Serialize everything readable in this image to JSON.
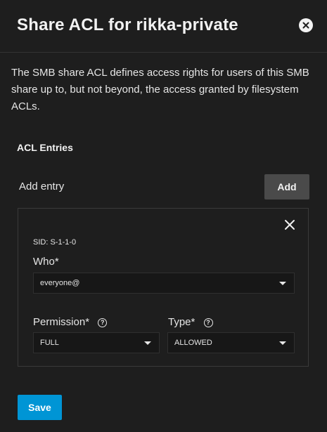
{
  "dialog": {
    "title": "Share ACL for rikka-private",
    "description": "The SMB share ACL defines access rights for users of this SMB share up to, but not beyond, the access granted by filesystem ACLs."
  },
  "acl": {
    "section_title": "ACL Entries",
    "add_label": "Add entry",
    "add_button": "Add",
    "entry": {
      "sid": "SID: S-1-1-0",
      "who_label": "Who",
      "who_value": "everyone@",
      "permission_label": "Permission",
      "permission_value": "FULL",
      "type_label": "Type",
      "type_value": "ALLOWED",
      "required_mark": "*",
      "help_glyph": "?"
    }
  },
  "footer": {
    "save_button": "Save"
  },
  "colors": {
    "background": "#1e1e1e",
    "accent": "#0095d5",
    "secondary_button": "#4a4a4a"
  },
  "icons": [
    "close-circle-icon",
    "close-icon",
    "help-icon",
    "caret-down-icon"
  ]
}
